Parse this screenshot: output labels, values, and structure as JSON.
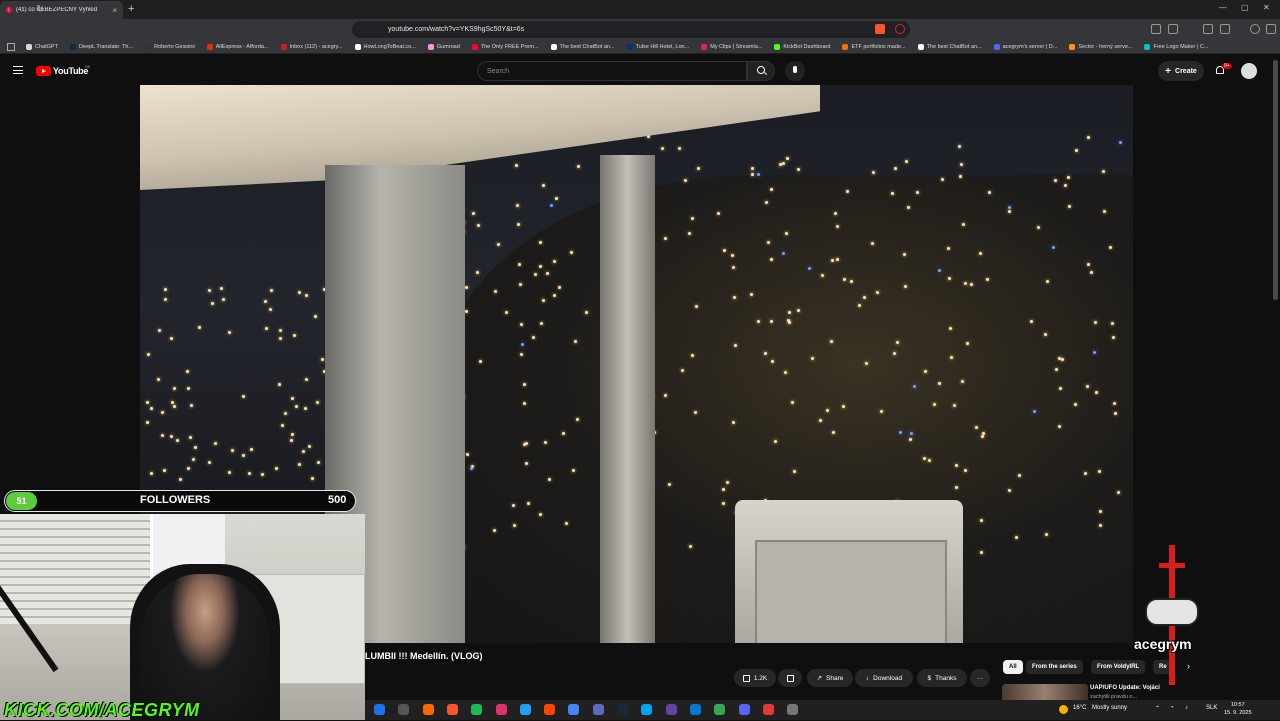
{
  "browser": {
    "tab_title": "(41) co NEBEZPEČNÝ Výhled",
    "tab_close": "×",
    "new_tab": "+",
    "url": "youtube.com/watch?v=YKS9hgSc50Y&t=6s",
    "window_controls": [
      "—",
      "▢",
      "✕"
    ],
    "bookmarks": [
      {
        "label": "ChatGPT",
        "color": "#d9d9d9"
      },
      {
        "label": "DeepL Translate: Th...",
        "color": "#0f2b46"
      },
      {
        "label": "Roberto Geissini",
        "color": "#333333"
      },
      {
        "label": "AliExpress - Afforda...",
        "color": "#e62e04"
      },
      {
        "label": "Inbox (112) - acegry...",
        "color": "#c5221f"
      },
      {
        "label": "HowLongToBeat.co...",
        "color": "#ffffff"
      },
      {
        "label": "Gumroad",
        "color": "#ff90e8"
      },
      {
        "label": "The Only FREE Prem...",
        "color": "#ff0033"
      },
      {
        "label": "The best ChatBot an...",
        "color": "#ffffff"
      },
      {
        "label": "Tulse Hill Hotel, Lon...",
        "color": "#003580"
      },
      {
        "label": "My Clips | Streamla...",
        "color": "#e91e63"
      },
      {
        "label": "KickBot Dashboard",
        "color": "#53fc18"
      },
      {
        "label": "ETF portfolios made...",
        "color": "#ff6d00"
      },
      {
        "label": "The best ChatBot an...",
        "color": "#ffffff"
      },
      {
        "label": "acegrym's server | D...",
        "color": "#5865f2"
      },
      {
        "label": "Sector - herný serve...",
        "color": "#ff9800"
      },
      {
        "label": "Free Logo Maker | C...",
        "color": "#00c4cc"
      }
    ]
  },
  "youtube": {
    "logo": "YouTube",
    "country": "SK",
    "search_placeholder": "Search",
    "create_label": "Create",
    "notifications_badge": "9+",
    "video_title": "LUMBII !!! Medellín. (VLOG)",
    "likes": "1.2K",
    "share": "Share",
    "download": "Download",
    "thanks": "Thanks",
    "more": "···",
    "chips": [
      "All",
      "From the series",
      "From VoldyIRL",
      "Re"
    ],
    "next_video_title": "UAP/UFO Update: Vojáci",
    "next_video_sub": "zachytili pravdu o..."
  },
  "stream_overlay": {
    "followers_current": "51",
    "followers_label": "FOLLOWERS",
    "followers_goal": "500",
    "followers_progress": 0.102,
    "kick_url": "KICK.COM/ACEGRYM",
    "brand": "acegrym"
  },
  "taskbar": {
    "weather": "16°C",
    "weather_desc": "Mostly sunny",
    "lang": "SLK",
    "time": "10:57",
    "date": "15. 9. 2025",
    "app_colors": [
      "#1a73e8",
      "#555555",
      "#ff6600",
      "#fb542b",
      "#1db954",
      "#e1306c",
      "#1da1f2",
      "#ff4500",
      "#4285f4",
      "#5c6bc0",
      "#1b2838",
      "#00a4ef",
      "#6441a5",
      "#0078d4",
      "#34a853",
      "#5865f2",
      "#e53935",
      "#777777"
    ]
  }
}
